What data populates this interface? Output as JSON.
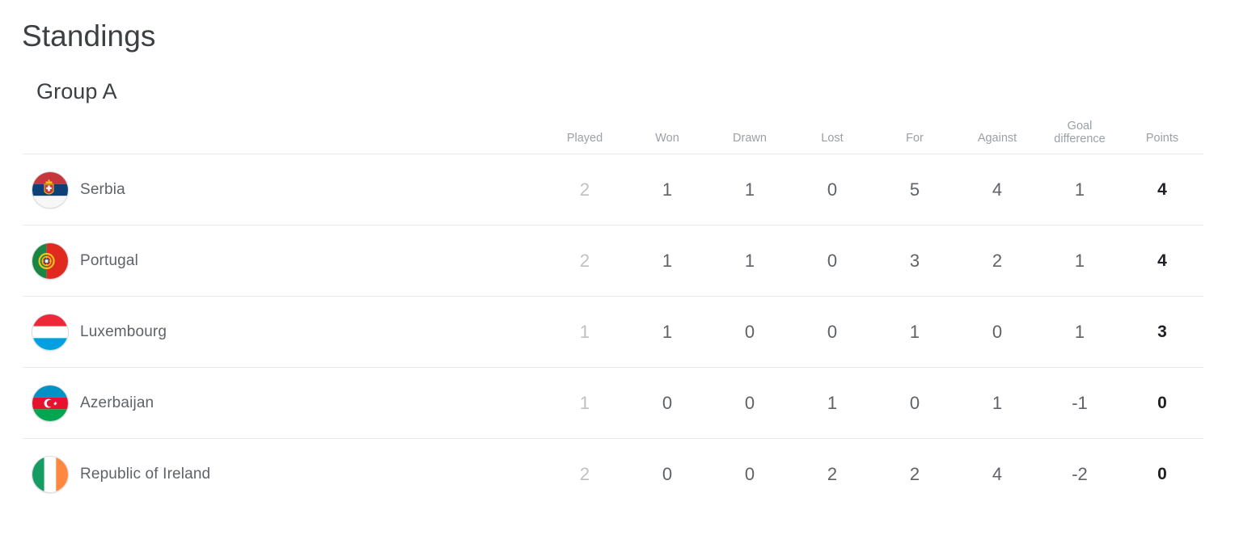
{
  "header": {
    "title": "Standings"
  },
  "group": {
    "title": "Group A"
  },
  "table": {
    "columns": [
      {
        "key": "team",
        "label": ""
      },
      {
        "key": "played",
        "label": "Played"
      },
      {
        "key": "won",
        "label": "Won"
      },
      {
        "key": "drawn",
        "label": "Drawn"
      },
      {
        "key": "lost",
        "label": "Lost"
      },
      {
        "key": "for",
        "label": "For"
      },
      {
        "key": "against",
        "label": "Against"
      },
      {
        "key": "gd_line1",
        "label": "Goal"
      },
      {
        "key": "gd_line2",
        "label": "difference"
      },
      {
        "key": "points",
        "label": "Points"
      }
    ],
    "rows": [
      {
        "team": "Serbia",
        "flag": "flag-serbia",
        "played": "2",
        "won": "1",
        "drawn": "1",
        "lost": "0",
        "for": "5",
        "against": "4",
        "goal_difference": "1",
        "points": "4"
      },
      {
        "team": "Portugal",
        "flag": "flag-portugal",
        "played": "2",
        "won": "1",
        "drawn": "1",
        "lost": "0",
        "for": "3",
        "against": "2",
        "goal_difference": "1",
        "points": "4"
      },
      {
        "team": "Luxembourg",
        "flag": "flag-luxembourg",
        "played": "1",
        "won": "1",
        "drawn": "0",
        "lost": "0",
        "for": "1",
        "against": "0",
        "goal_difference": "1",
        "points": "3"
      },
      {
        "team": "Azerbaijan",
        "flag": "flag-azerbaijan",
        "played": "1",
        "won": "0",
        "drawn": "0",
        "lost": "1",
        "for": "0",
        "against": "1",
        "goal_difference": "-1",
        "points": "0"
      },
      {
        "team": "Republic of Ireland",
        "flag": "flag-republic-of-ireland",
        "played": "2",
        "won": "0",
        "drawn": "0",
        "lost": "2",
        "for": "2",
        "against": "4",
        "goal_difference": "-2",
        "points": "0"
      }
    ]
  },
  "colors": {
    "page_background": "#ffffff",
    "title_text": "#3c4043",
    "header_text": "#9aa0a6",
    "team_text": "#5f6368",
    "stat_text": "#5f6368",
    "muted_stat_text": "#bdc1c6",
    "points_text": "#202124",
    "divider": "#e8eaed"
  }
}
